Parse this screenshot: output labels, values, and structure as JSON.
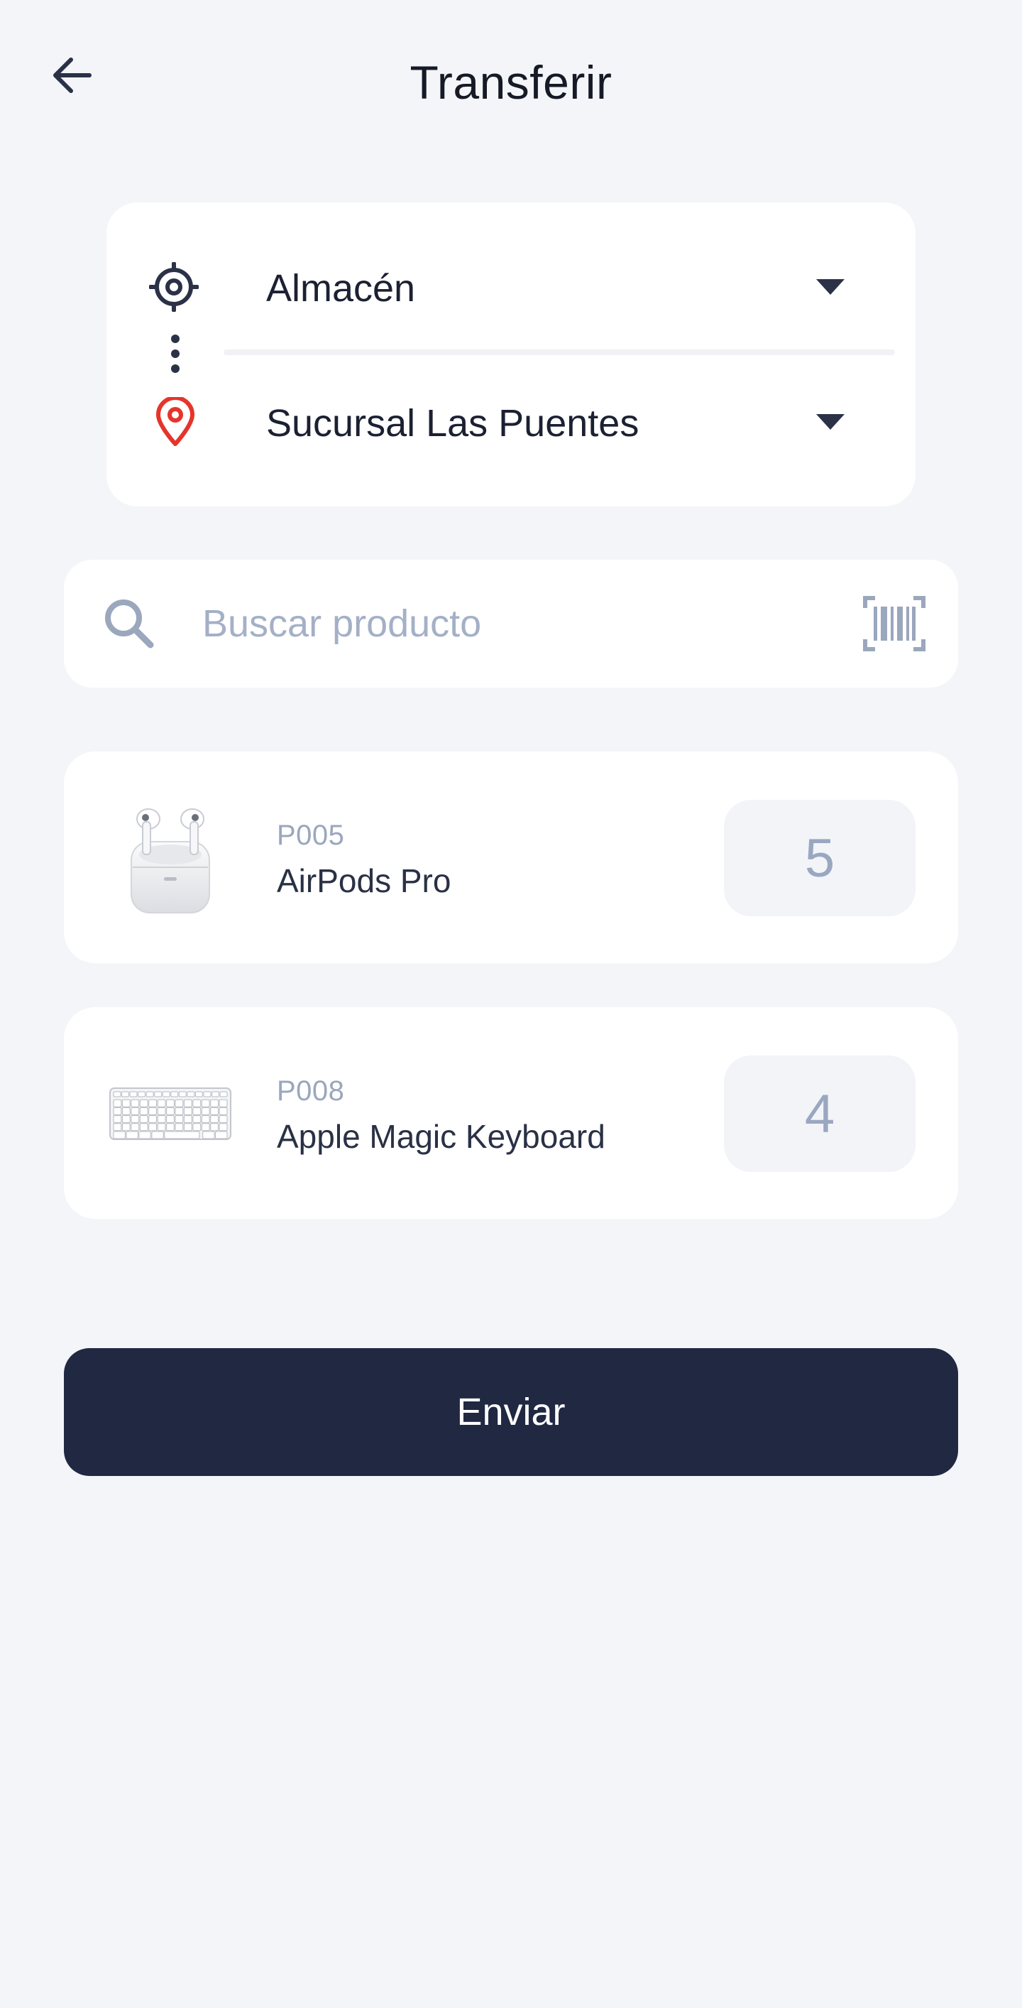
{
  "header": {
    "title": "Transferir"
  },
  "route": {
    "origin": "Almacén",
    "destination": "Sucursal Las Puentes"
  },
  "search": {
    "placeholder": "Buscar producto"
  },
  "products": [
    {
      "code": "P005",
      "name": "AirPods Pro",
      "quantity": "5",
      "image": "airpods-pro-image"
    },
    {
      "code": "P008",
      "name": "Apple Magic Keyboard",
      "quantity": "4",
      "image": "magic-keyboard-image"
    }
  ],
  "actions": {
    "send_label": "Enviar"
  },
  "icons": {
    "back": "back-arrow-icon",
    "origin": "target-icon",
    "destination": "location-pin-icon",
    "search": "search-icon",
    "scan": "barcode-scan-icon",
    "dropdown": "caret-down-icon"
  },
  "colors": {
    "background": "#f4f5f9",
    "card": "#ffffff",
    "primary_button": "#202842",
    "destination_pin": "#e5352b",
    "muted_text": "#9aa7bd",
    "placeholder": "#a4b0c6"
  }
}
